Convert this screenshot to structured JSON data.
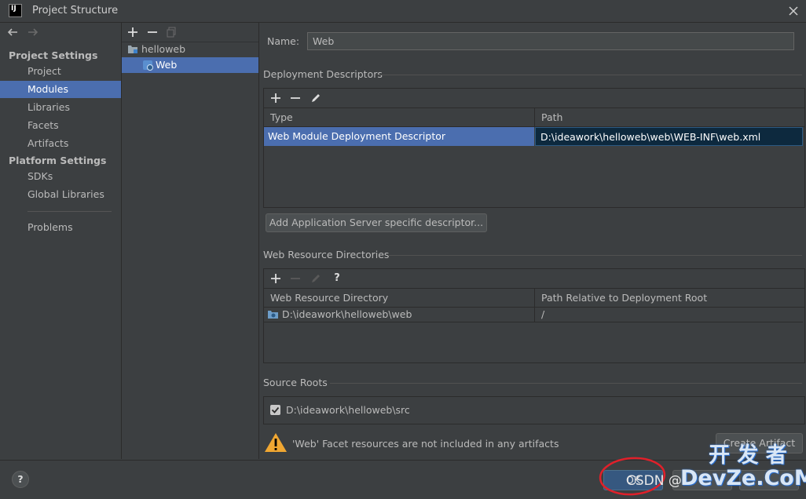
{
  "window": {
    "title": "Project Structure",
    "logo_text": "IJ"
  },
  "nav": {
    "project_settings_header": "Project Settings",
    "project_items": [
      "Project",
      "Modules",
      "Libraries",
      "Facets",
      "Artifacts"
    ],
    "platform_settings_header": "Platform Settings",
    "platform_items": [
      "SDKs",
      "Global Libraries"
    ],
    "problems": "Problems",
    "selected": "Modules"
  },
  "tree": {
    "items": [
      {
        "label": "helloweb"
      },
      {
        "label": "Web"
      }
    ]
  },
  "name": {
    "label": "Name:",
    "value": "Web"
  },
  "deployment": {
    "header": "Deployment Descriptors",
    "columns": [
      "Type",
      "Path"
    ],
    "rows": [
      {
        "type": "Web Module Deployment Descriptor",
        "path": "D:\\ideawork\\helloweb\\web\\WEB-INF\\web.xml"
      }
    ],
    "add_button": "Add Application Server specific descriptor..."
  },
  "web_resources": {
    "header": "Web Resource Directories",
    "help": "?",
    "columns": [
      "Web Resource Directory",
      "Path Relative to Deployment Root"
    ],
    "rows": [
      {
        "dir": "D:\\ideawork\\helloweb\\web",
        "relative": "/"
      }
    ]
  },
  "source_roots": {
    "header": "Source Roots",
    "items": [
      {
        "path": "D:\\ideawork\\helloweb\\src",
        "checked": true
      }
    ]
  },
  "warning": {
    "text": "'Web' Facet resources are not included in any artifacts",
    "button": "Create Artifact"
  },
  "footer": {
    "help": "?",
    "ok": "OK"
  },
  "watermark": {
    "left": "CSDN @",
    "right": "开 发 者\nDevZe.CoM"
  },
  "colors": {
    "selection": "#4b6eaf",
    "background": "#3c3f41",
    "warning": "#f0a732",
    "annotation": "#e0202a"
  }
}
